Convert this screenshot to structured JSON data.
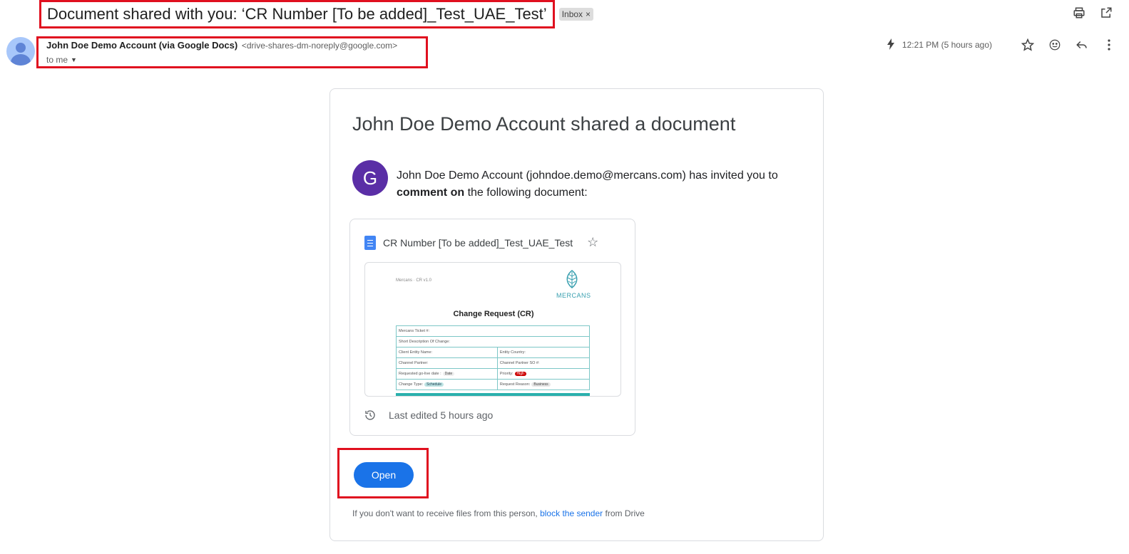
{
  "email": {
    "subject": "Document shared with you: ‘CR Number [To be added]_Test_UAE_Test’",
    "label_chip": "Inbox",
    "label_chip_close": "×",
    "sender": {
      "name": "John Doe Demo Account (via Google Docs)",
      "email": "<drive-shares-dm-noreply@google.com>",
      "to": "to me"
    },
    "time": "12:21 PM (5 hours ago)",
    "icons": {
      "print": "print-icon",
      "open_new": "open-in-new-icon",
      "bolt": "bolt-icon",
      "star": "star-icon",
      "emoji": "emoji-icon",
      "reply": "reply-icon",
      "more": "more-vert-icon"
    }
  },
  "card": {
    "title": "John Doe Demo Account shared a document",
    "avatar_letter": "G",
    "avatar_color": "#5a2ea6",
    "invite_prefix": "John Doe Demo Account (johndoe.demo@mercans.com) has invited you to",
    "invite_bold": "comment on",
    "invite_suffix": " the following document:",
    "doc": {
      "name": "CR Number [To be added]_Test_UAE_Test",
      "last_edited": "Last edited 5 hours ago",
      "preview": {
        "top_label": "Mercans · CR v1.0",
        "brand": "MERCANS",
        "title": "Change Request (CR)",
        "rows": [
          [
            "Mercans Ticket #:"
          ],
          [
            "Short Description Of Change:"
          ],
          [
            "Client Entity Name:",
            "Entity Country:"
          ],
          [
            "Channel Partner:",
            "Channel Partner SO #:"
          ],
          [
            "Requested go-live date :",
            "Priority:"
          ],
          [
            "Change Type:",
            "Request Reason:"
          ]
        ],
        "chip_date": "Date",
        "chip_high": "High",
        "chip_schedule": "Schedule",
        "chip_business": "Business"
      }
    },
    "open_label": "Open",
    "footer_prefix": "If you don't want to receive files from this person, ",
    "footer_link": "block the sender",
    "footer_suffix": " from Drive"
  },
  "colors": {
    "accent": "#1a73e8",
    "highlight_box": "#e0101f",
    "doc_icon": "#4285f4"
  }
}
